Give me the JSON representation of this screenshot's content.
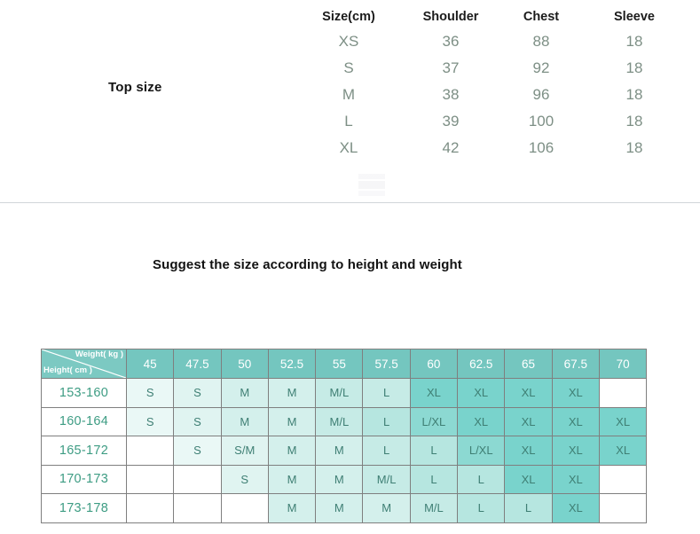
{
  "top_section": {
    "label": "Top size",
    "table": {
      "headers": [
        "Size(cm)",
        "Shoulder",
        "Chest",
        "Sleeve"
      ],
      "rows": [
        {
          "size": "XS",
          "shoulder": "36",
          "chest": "88",
          "sleeve": "18"
        },
        {
          "size": "S",
          "shoulder": "37",
          "chest": "92",
          "sleeve": "18"
        },
        {
          "size": "M",
          "shoulder": "38",
          "chest": "96",
          "sleeve": "18"
        },
        {
          "size": "L",
          "shoulder": "39",
          "chest": "100",
          "sleeve": "18"
        },
        {
          "size": "XL",
          "shoulder": "42",
          "chest": "106",
          "sleeve": "18"
        }
      ]
    }
  },
  "suggestion": {
    "heading": "Suggest the size according to height and weight"
  },
  "matrix": {
    "corner": {
      "weight_label": "Weight( kg )",
      "height_label": "Height( cm )"
    },
    "weight_headers": [
      "45",
      "47.5",
      "50",
      "52.5",
      "55",
      "57.5",
      "60",
      "62.5",
      "65",
      "67.5",
      "70"
    ],
    "rows": [
      {
        "height": "153-160",
        "cells": [
          "S",
          "S",
          "M",
          "M",
          "M/L",
          "L",
          "XL",
          "XL",
          "XL",
          "XL",
          ""
        ],
        "shades": [
          1,
          2,
          3,
          3,
          4,
          4,
          8,
          8,
          8,
          8,
          0
        ]
      },
      {
        "height": "160-164",
        "cells": [
          "S",
          "S",
          "M",
          "M",
          "M/L",
          "L",
          "L/XL",
          "XL",
          "XL",
          "XL",
          "XL"
        ],
        "shades": [
          1,
          2,
          3,
          3,
          4,
          5,
          7,
          8,
          8,
          8,
          8
        ]
      },
      {
        "height": "165-172",
        "cells": [
          "",
          "S",
          "S/M",
          "M",
          "M",
          "L",
          "L",
          "L/XL",
          "XL",
          "XL",
          "XL"
        ],
        "shades": [
          0,
          1,
          2,
          3,
          3,
          4,
          5,
          7,
          8,
          8,
          8
        ]
      },
      {
        "height": "170-173",
        "cells": [
          "",
          "",
          "S",
          "M",
          "M",
          "M/L",
          "L",
          "L",
          "XL",
          "XL",
          ""
        ],
        "shades": [
          0,
          0,
          2,
          3,
          3,
          4,
          5,
          5,
          8,
          8,
          0
        ]
      },
      {
        "height": "173-178",
        "cells": [
          "",
          "",
          "",
          "M",
          "M",
          "M",
          "M/L",
          "L",
          "L",
          "XL",
          ""
        ],
        "shades": [
          0,
          0,
          0,
          3,
          3,
          3,
          4,
          5,
          5,
          8,
          0
        ]
      }
    ]
  },
  "colors": {
    "header_teal": "#74c6bf",
    "corner_teal": "#7cc9c2",
    "cell_text": "#3f7f74",
    "height_label_text": "#3d9c83",
    "top_table_value_text": "#7d8f85",
    "heading_text": "#121212",
    "divider": "#c9ced2"
  }
}
